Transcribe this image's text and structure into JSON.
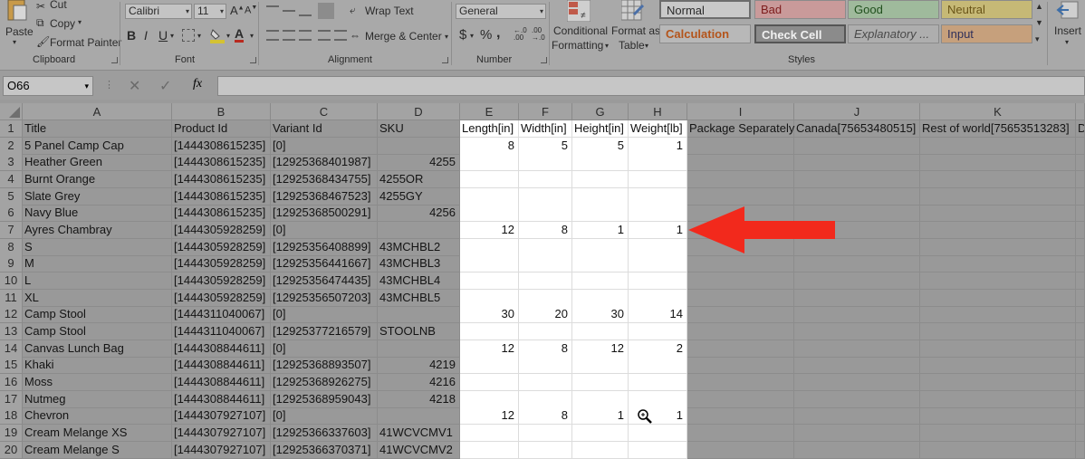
{
  "ribbon": {
    "clipboard": {
      "paste": "Paste",
      "cut": "Cut",
      "copy": "Copy",
      "format_painter": "Format Painter",
      "group": "Clipboard"
    },
    "font": {
      "name": "Calibri",
      "size": "11",
      "bold": "B",
      "italic": "I",
      "underline": "U",
      "group": "Font"
    },
    "alignment": {
      "wrap_text": "Wrap Text",
      "merge_center": "Merge & Center",
      "group": "Alignment"
    },
    "number": {
      "format": "General",
      "currency": "$",
      "percent": "%",
      "comma": ",",
      "inc_decimal": "←.0 .00",
      "dec_decimal": ".00 →.0",
      "group": "Number"
    },
    "styles": {
      "conditional_1": "Conditional",
      "conditional_2": "Formatting",
      "format_as_1": "Format as",
      "format_as_2": "Table",
      "normal": "Normal",
      "bad": "Bad",
      "good": "Good",
      "neutral": "Neutral",
      "calculation": "Calculation",
      "check_cell": "Check Cell",
      "explanatory": "Explanatory ...",
      "input": "Input",
      "group": "Styles"
    },
    "cells": {
      "insert": "Insert"
    }
  },
  "formula_bar": {
    "name_box": "O66",
    "fx": "fx",
    "formula": ""
  },
  "columns": [
    "A",
    "B",
    "C",
    "D",
    "E",
    "F",
    "G",
    "H",
    "I",
    "J",
    "K"
  ],
  "rows": [
    {
      "n": "1",
      "A": "Title",
      "B": "Product Id",
      "C": "Variant Id",
      "D": "SKU",
      "E": "Length[in]",
      "F": "Width[in]",
      "G": "Height[in]",
      "H": "Weight[lb]",
      "I": "Package Separately",
      "J": "Canada[75653480515]",
      "K": "Rest of world[75653513283]",
      "L": "D"
    },
    {
      "n": "2",
      "A": "5 Panel Camp Cap",
      "B": "[1444308615235]",
      "C": "[0]",
      "D": "",
      "E": "8",
      "F": "5",
      "G": "5",
      "H": "1"
    },
    {
      "n": "3",
      "A": "Heather Green",
      "B": "[1444308615235]",
      "C": "[12925368401987]",
      "D": "4255",
      "E": "",
      "F": "",
      "G": "",
      "H": ""
    },
    {
      "n": "4",
      "A": "Burnt Orange",
      "B": "[1444308615235]",
      "C": "[12925368434755]",
      "D": "4255OR",
      "E": "",
      "F": "",
      "G": "",
      "H": ""
    },
    {
      "n": "5",
      "A": "Slate Grey",
      "B": "[1444308615235]",
      "C": "[12925368467523]",
      "D": "4255GY",
      "E": "",
      "F": "",
      "G": "",
      "H": ""
    },
    {
      "n": "6",
      "A": "Navy Blue",
      "B": "[1444308615235]",
      "C": "[12925368500291]",
      "D": "4256",
      "E": "",
      "F": "",
      "G": "",
      "H": ""
    },
    {
      "n": "7",
      "A": "Ayres Chambray",
      "B": "[1444305928259]",
      "C": "[0]",
      "D": "",
      "E": "12",
      "F": "8",
      "G": "1",
      "H": "1"
    },
    {
      "n": "8",
      "A": "S",
      "B": "[1444305928259]",
      "C": "[12925356408899]",
      "D": "43MCHBL2",
      "E": "",
      "F": "",
      "G": "",
      "H": ""
    },
    {
      "n": "9",
      "A": "M",
      "B": "[1444305928259]",
      "C": "[12925356441667]",
      "D": "43MCHBL3",
      "E": "",
      "F": "",
      "G": "",
      "H": ""
    },
    {
      "n": "10",
      "A": "L",
      "B": "[1444305928259]",
      "C": "[12925356474435]",
      "D": "43MCHBL4",
      "E": "",
      "F": "",
      "G": "",
      "H": ""
    },
    {
      "n": "11",
      "A": "XL",
      "B": "[1444305928259]",
      "C": "[12925356507203]",
      "D": "43MCHBL5",
      "E": "",
      "F": "",
      "G": "",
      "H": ""
    },
    {
      "n": "12",
      "A": "Camp Stool",
      "B": "[1444311040067]",
      "C": "[0]",
      "D": "",
      "E": "30",
      "F": "20",
      "G": "30",
      "H": "14"
    },
    {
      "n": "13",
      "A": "Camp Stool",
      "B": "[1444311040067]",
      "C": "[12925377216579]",
      "D": "STOOLNB",
      "E": "",
      "F": "",
      "G": "",
      "H": ""
    },
    {
      "n": "14",
      "A": "Canvas Lunch Bag",
      "B": "[1444308844611]",
      "C": "[0]",
      "D": "",
      "E": "12",
      "F": "8",
      "G": "12",
      "H": "2"
    },
    {
      "n": "15",
      "A": "Khaki",
      "B": "[1444308844611]",
      "C": "[12925368893507]",
      "D": "4219",
      "E": "",
      "F": "",
      "G": "",
      "H": ""
    },
    {
      "n": "16",
      "A": "Moss",
      "B": "[1444308844611]",
      "C": "[12925368926275]",
      "D": "4216",
      "E": "",
      "F": "",
      "G": "",
      "H": ""
    },
    {
      "n": "17",
      "A": "Nutmeg",
      "B": "[1444308844611]",
      "C": "[12925368959043]",
      "D": "4218",
      "E": "",
      "F": "",
      "G": "",
      "H": ""
    },
    {
      "n": "18",
      "A": "Chevron",
      "B": "[1444307927107]",
      "C": "[0]",
      "D": "",
      "E": "12",
      "F": "8",
      "G": "1",
      "H": "1"
    },
    {
      "n": "19",
      "A": "Cream Melange  XS",
      "B": "[1444307927107]",
      "C": "[12925366337603]",
      "D": "41WCVCMV1",
      "E": "",
      "F": "",
      "G": "",
      "H": ""
    },
    {
      "n": "20",
      "A": "Cream Melange  S",
      "B": "[1444307927107]",
      "C": "[12925366370371]",
      "D": "41WCVCMV2",
      "E": "",
      "F": "",
      "G": "",
      "H": ""
    }
  ],
  "colors": {
    "arrow": "#f2291c",
    "highlight": "#ffffff",
    "dim": "#999999"
  }
}
